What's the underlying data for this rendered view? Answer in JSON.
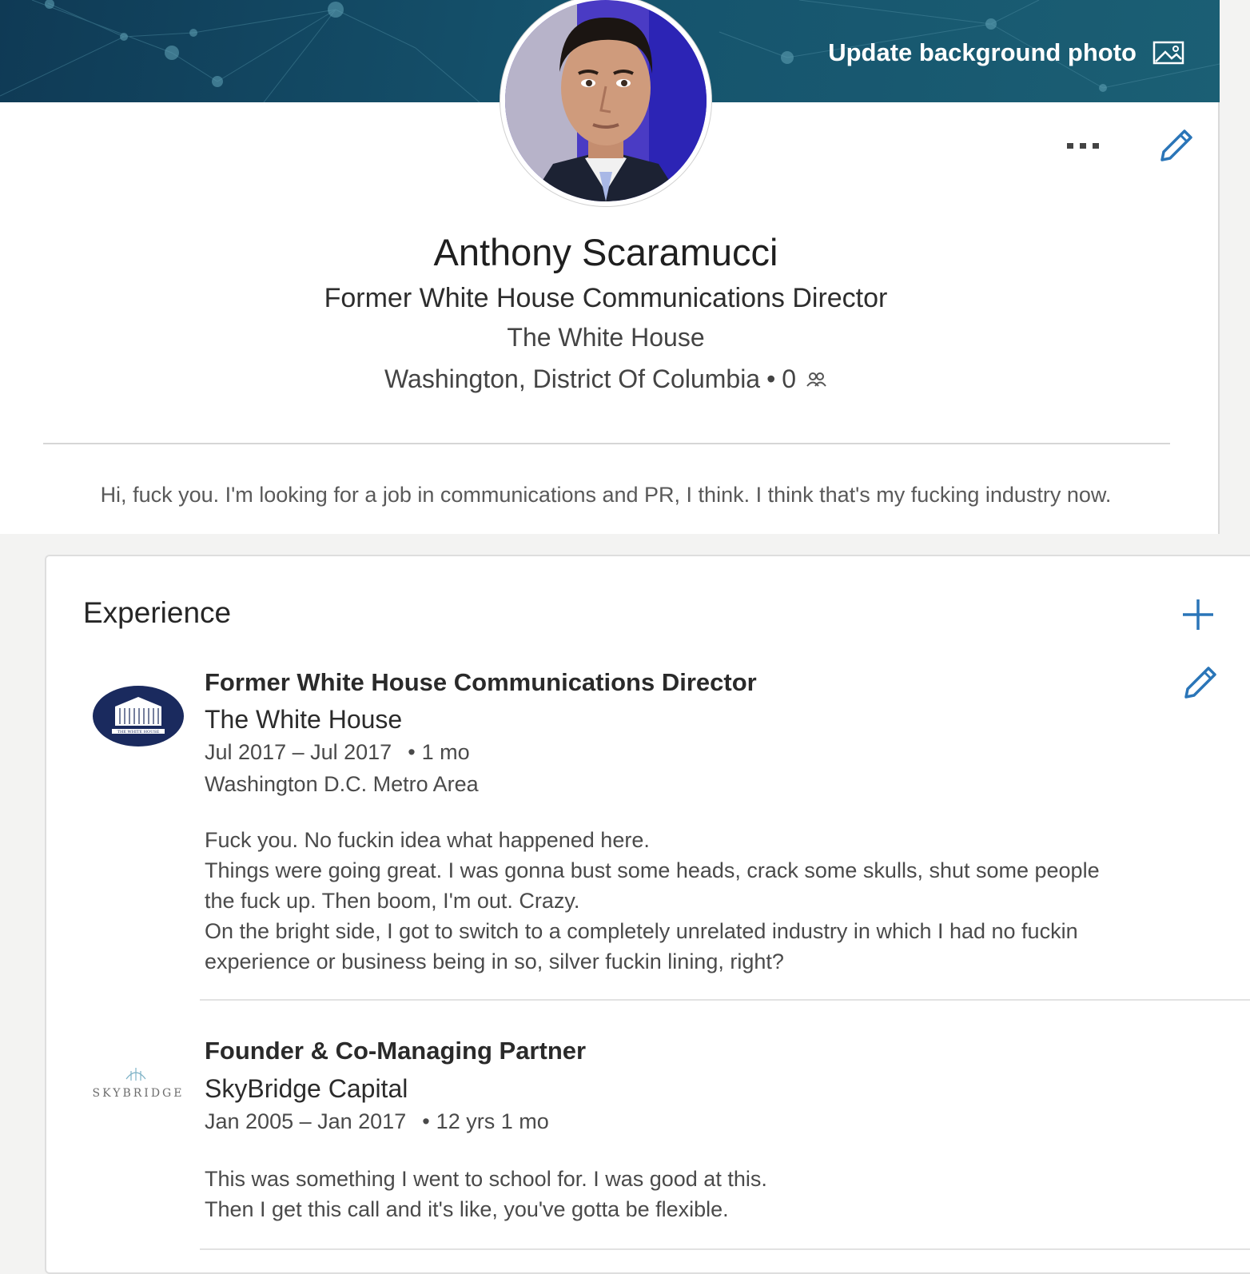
{
  "header": {
    "update_background_label": "Update background photo"
  },
  "profile": {
    "name": "Anthony Scaramucci",
    "headline": "Former White House Communications Director",
    "company": "The White House",
    "location": "Washington, District Of Columbia",
    "connections": "0",
    "summary": "Hi, fuck you. I'm looking for a job in communications and PR, I think. I think that's my fucking industry now."
  },
  "experience": {
    "section_title": "Experience",
    "items": [
      {
        "title": "Former White House Communications Director",
        "company": "The White House",
        "dates": "Jul 2017 – Jul 2017",
        "duration": "1 mo",
        "location": "Washington D.C. Metro Area",
        "description": [
          "Fuck you. No fuckin idea what happened here.",
          "Things were going great. I was gonna bust some heads, crack some skulls, shut some people the fuck up. Then boom, I'm out. Crazy.",
          "On the bright side, I got to switch to a completely unrelated industry in which I had no fuckin experience or business being in so, silver fuckin lining, right?"
        ],
        "logo_text": "THE WHITE HOUSE"
      },
      {
        "title": "Founder & Co-Managing Partner",
        "company": "SkyBridge Capital",
        "dates": "Jan 2005 – Jan 2017",
        "duration": "12 yrs 1 mo",
        "description": [
          "This was something I went to school for. I was good at this.",
          "Then I get this call and it's like, you've gotta be flexible."
        ],
        "logo_text": "SKYBRIDGE"
      }
    ]
  },
  "colors": {
    "accent": "#2a75b8",
    "banner": "#15526c"
  },
  "icons": {
    "update_background": "image-icon",
    "more": "more-icon",
    "edit": "pencil-icon",
    "add": "plus-icon",
    "connections": "people-icon"
  }
}
